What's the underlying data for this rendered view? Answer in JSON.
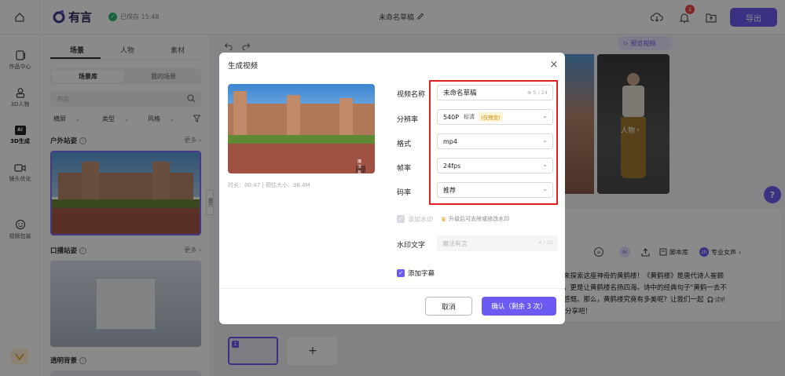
{
  "app": {
    "name": "有言",
    "saved_status": "已保存 15:48",
    "draft_title": "未命名草稿",
    "notification_count": "1",
    "export_label": "导出",
    "preview_video_label": "预览视频"
  },
  "nav": [
    {
      "label": "作品中心",
      "icon": "folder-icon"
    },
    {
      "label": "3D人物",
      "icon": "avatar-icon"
    },
    {
      "label": "3D生成",
      "icon": "ai-icon"
    },
    {
      "label": "镜头优化",
      "icon": "camera-icon"
    },
    {
      "label": "视频包装",
      "icon": "package-icon"
    }
  ],
  "panel": {
    "tabs": [
      "场景",
      "人物",
      "素材"
    ],
    "subtabs": [
      "场景库",
      "我的场景"
    ],
    "search_placeholder": "书店",
    "filters": [
      "横屏",
      "类型",
      "风格"
    ],
    "sections": [
      {
        "title": "户外站姿",
        "more": "更多"
      },
      {
        "title": "口播站姿",
        "more": "更多"
      },
      {
        "title": "透明背景"
      }
    ],
    "expand_label": "展开"
  },
  "editor": {
    "character_label": "人物",
    "script_lib_label": "脚本库",
    "voice_label": "专业女声",
    "voice_avatar": "zh",
    "script_line1": "来探索这座神奇的黄鹤楼！《黄鹤楼》是唐代诗人崔颢",
    "script_line2": "，更是让黄鹤楼名扬四海。诗中的经典句子\"黄鹤一去不",
    "script_line3": "感慨。那么，黄鹤楼究竟有多美呢？让我们一起",
    "script_line4": "分享吧！",
    "listen_label": "试听",
    "help_label": "?",
    "add_label": "+"
  },
  "dialog": {
    "title": "生成视频",
    "close": "×",
    "meta": "时长：00:47 | 预估大小：38.4M",
    "thumb_brand": "魔法有言",
    "fields": {
      "name": {
        "label": "视频名称",
        "value": "未命名草稿",
        "count": "5 / 24"
      },
      "resolution": {
        "label": "分辨率",
        "value": "540P",
        "tag": "标清",
        "badge": "(仅预览)"
      },
      "format": {
        "label": "格式",
        "value": "mp4"
      },
      "framerate": {
        "label": "帧率",
        "value": "24fps"
      },
      "bitrate": {
        "label": "码率",
        "value": "推荐"
      }
    },
    "watermark_label": "添加水印",
    "upgrade_hint": "升级后可去除或修改水印",
    "watermark_text_label": "水印文字",
    "watermark_text_placeholder": "魔法有言",
    "watermark_count": "4 / 10",
    "subtitle_label": "添加字幕",
    "cancel": "取消",
    "confirm": "确认（剩余 3 次）"
  },
  "colors": {
    "accent": "#6b5bf0",
    "highlight": "#e02020",
    "badge_bg": "#fff3d6",
    "badge_text": "#d48806"
  }
}
